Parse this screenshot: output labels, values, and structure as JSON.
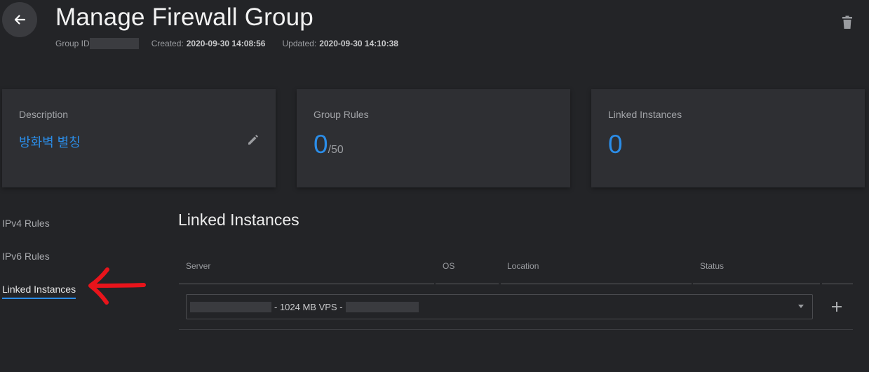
{
  "header": {
    "title": "Manage Firewall Group",
    "group_id_label": "Group ID",
    "created_label": "Created:",
    "created_value": "2020-09-30 14:08:56",
    "updated_label": "Updated:",
    "updated_value": "2020-09-30 14:10:38"
  },
  "cards": {
    "description": {
      "label": "Description",
      "value": "방화벽 별칭"
    },
    "group_rules": {
      "label": "Group Rules",
      "count": "0",
      "max": "/50"
    },
    "linked_instances": {
      "label": "Linked Instances",
      "count": "0"
    }
  },
  "side_nav": {
    "items": [
      {
        "label": "IPv4 Rules"
      },
      {
        "label": "IPv6 Rules"
      },
      {
        "label": "Linked Instances"
      }
    ]
  },
  "section": {
    "title": "Linked Instances",
    "columns": [
      "Server",
      "OS",
      "Location",
      "Status"
    ],
    "server_select_text": "- 1024 MB VPS -"
  },
  "colors": {
    "accent": "#2b8de8",
    "annotation": "#e8141b",
    "background": "#232427"
  }
}
